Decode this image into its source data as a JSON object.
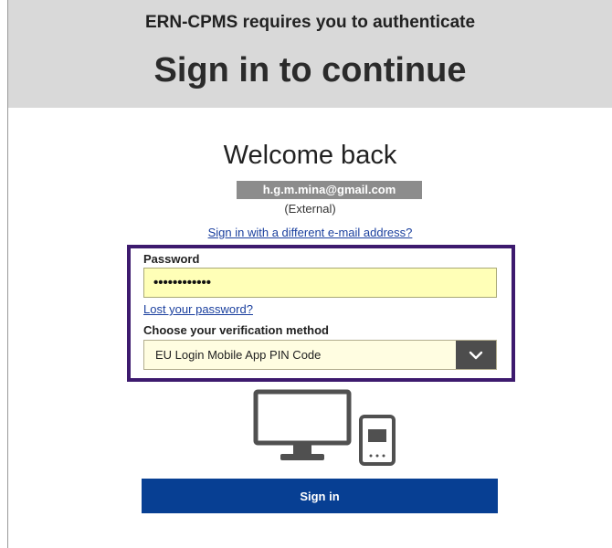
{
  "header": {
    "subtitle": "ERN-CPMS requires you to authenticate",
    "title": "Sign in to continue"
  },
  "card": {
    "welcome": "Welcome back",
    "email": "h.g.m.mina@gmail.com",
    "account_type": "(External)",
    "different_email_link": "Sign in with a different e-mail address?"
  },
  "form": {
    "password_label": "Password",
    "password_value": "••••••••••••",
    "lost_password_link": "Lost your password?",
    "verification_label": "Choose your verification method",
    "verification_selected": "EU Login Mobile App PIN Code"
  },
  "illustration": {
    "icon": "desktop-and-mobile-icon"
  },
  "actions": {
    "signin_label": "Sign in"
  },
  "colors": {
    "header_bg": "#d9d9d9",
    "highlight_border": "#3d1a6e",
    "password_bg": "#ffffb7",
    "primary_button": "#073f93",
    "link": "#1a3f9e"
  }
}
